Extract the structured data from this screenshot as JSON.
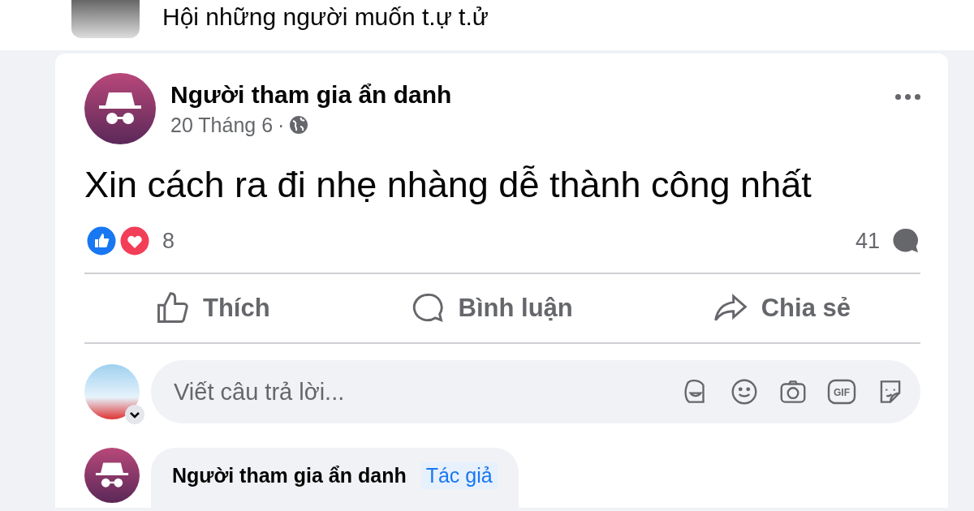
{
  "group": {
    "name": "Hội những người muốn t.ự t.ử"
  },
  "post": {
    "author": "Người tham gia ẩn danh",
    "date": "20 Tháng 6",
    "separator": "·",
    "text": "Xin cách ra đi nhẹ nhàng dễ thành công nhất",
    "reaction_count": "8",
    "comment_count": "41"
  },
  "actions": [
    {
      "kind": "like",
      "label": "Thích"
    },
    {
      "kind": "comment",
      "label": "Bình luận"
    },
    {
      "kind": "share",
      "label": "Chia sẻ"
    }
  ],
  "composer": {
    "placeholder": "Viết câu trả lời...",
    "gif_label": "GIF"
  },
  "comments": [
    {
      "author": "Người tham gia ẩn danh",
      "badge": "Tác giả"
    }
  ]
}
